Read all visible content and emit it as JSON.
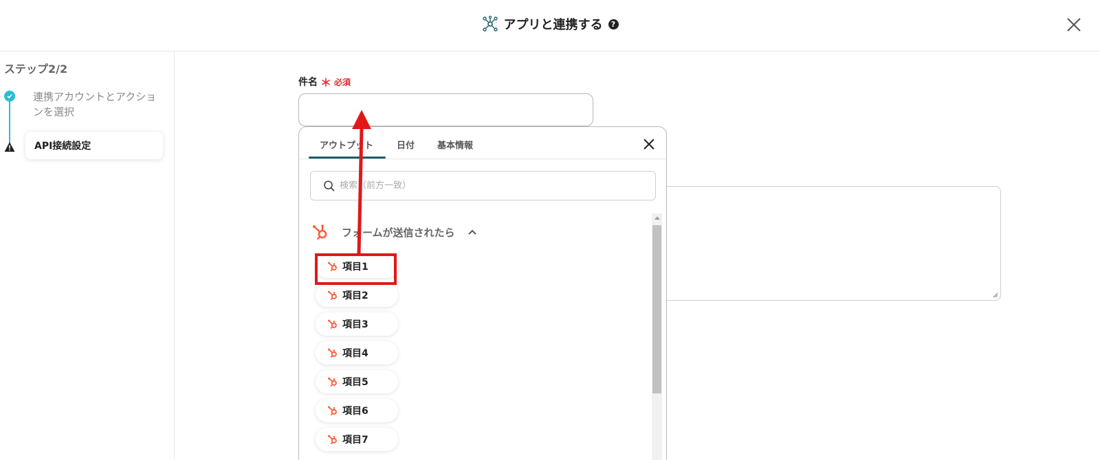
{
  "header": {
    "title": "アプリと連携する",
    "help": "?"
  },
  "sidebar": {
    "step_label": "ステップ2/2",
    "steps": [
      {
        "label": "連携アカウントとアクションを選択",
        "status": "done"
      },
      {
        "label": "API接続設定",
        "status": "warning"
      }
    ]
  },
  "form": {
    "subject_label": "件名",
    "required_mark": "＊",
    "required_text": "必須",
    "subject_value": ""
  },
  "popup": {
    "tabs": [
      {
        "label": "アウトプット",
        "active": true
      },
      {
        "label": "日付",
        "active": false
      },
      {
        "label": "基本情報",
        "active": false
      }
    ],
    "search_placeholder": "検索（前方一致）",
    "group_title": "フォームが送信されたら",
    "items": [
      "項目1",
      "項目2",
      "項目3",
      "項目4",
      "項目5",
      "項目6",
      "項目7"
    ]
  },
  "colors": {
    "accent": "#27bfd0",
    "tab_active": "#1c5d6b",
    "hubspot": "#ff5c35",
    "required": "#e3302f",
    "annotation": "#e01818"
  },
  "icons": {
    "app_link": "app-connect-icon",
    "close": "close-icon",
    "search": "search-icon",
    "hubspot": "hubspot-icon",
    "chevron": "chevron-up-icon"
  }
}
